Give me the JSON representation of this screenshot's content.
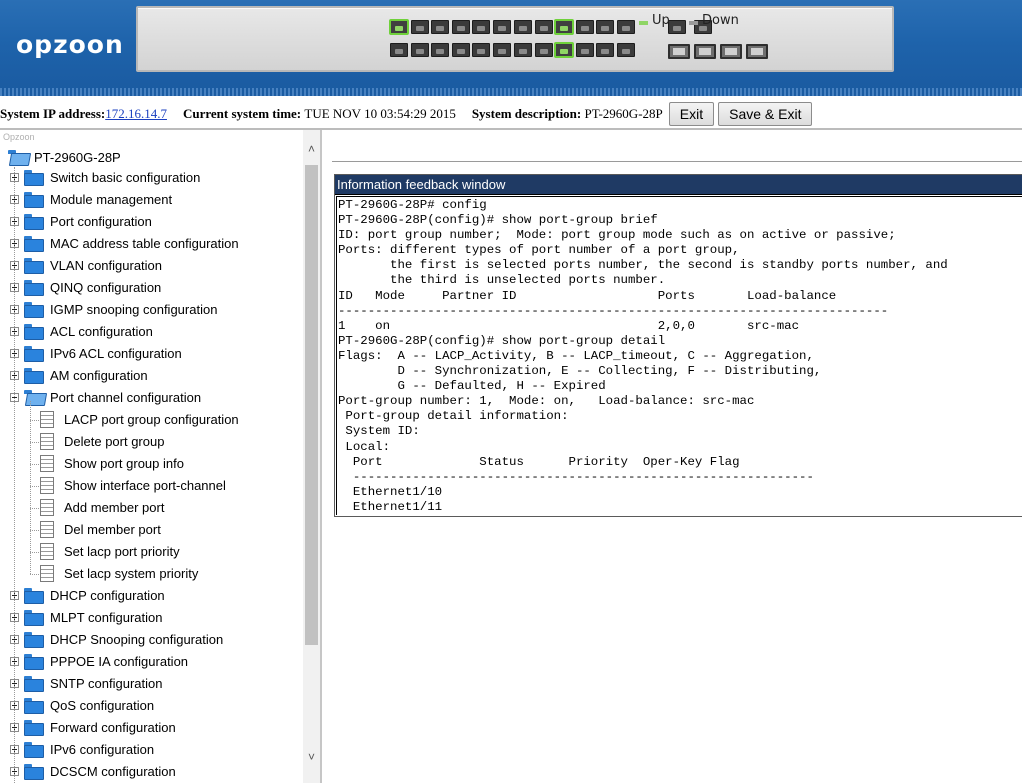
{
  "banner": {
    "logo": "opzoon",
    "legend": {
      "up_label": "Up",
      "down_label": "Down",
      "up_color": "#8fd565",
      "down_color": "#9a9a9a"
    },
    "ports": {
      "top_row_up": [
        1,
        9
      ],
      "bottom_row_up": [
        9
      ]
    }
  },
  "info_bar": {
    "ip_label": "System IP address:",
    "ip_value": "172.16.14.7",
    "time_label": "Current system time:",
    "time_value": "TUE NOV 10 03:54:29 2015",
    "desc_label": "System description:",
    "desc_value": "PT-2960G-28P",
    "exit_button": "Exit",
    "save_exit_button": "Save & Exit"
  },
  "tree": {
    "caption": "Opzoon",
    "root": "PT-2960G-28P",
    "top_items": [
      "Switch basic configuration",
      "Module management",
      "Port configuration",
      "MAC address table configuration",
      "VLAN configuration",
      "QINQ configuration",
      "IGMP snooping configuration",
      "ACL configuration",
      "IPv6 ACL configuration",
      "AM configuration"
    ],
    "expanded_item": "Port channel configuration",
    "sub_items": [
      "LACP port group configuration",
      "Delete port group",
      "Show port group info",
      "Show interface port-channel",
      "Add member port",
      "Del member port",
      "Set lacp port priority",
      "Set lacp system priority"
    ],
    "bottom_items": [
      "DHCP configuration",
      "MLPT configuration",
      "DHCP Snooping configuration",
      "PPPOE IA configuration",
      "SNTP configuration",
      "QoS configuration",
      "Forward configuration",
      "IPv6 configuration",
      "DCSCM configuration"
    ]
  },
  "feedback": {
    "title": "Information feedback window",
    "lines": [
      "PT-2960G-28P# config",
      "PT-2960G-28P(config)# show port-group brief",
      "ID: port group number;  Mode: port group mode such as on active or passive;",
      "Ports: different types of port number of a port group,",
      "       the first is selected ports number, the second is standby ports number, and",
      "       the third is unselected ports number.",
      "ID   Mode     Partner ID                   Ports       Load-balance",
      "--------------------------------------------------------------------------",
      "1    on                                    2,0,0       src-mac",
      "PT-2960G-28P(config)# show port-group detail",
      "Flags:  A -- LACP_Activity, B -- LACP_timeout, C -- Aggregation,",
      "        D -- Synchronization, E -- Collecting, F -- Distributing,",
      "        G -- Defaulted, H -- Expired",
      "Port-group number: 1,  Mode: on,   Load-balance: src-mac",
      " Port-group detail information:",
      " System ID:",
      " Local:",
      "  Port             Status      Priority  Oper-Key Flag",
      "  --------------------------------------------------------------",
      "  Ethernet1/10",
      "  Ethernet1/11"
    ]
  }
}
